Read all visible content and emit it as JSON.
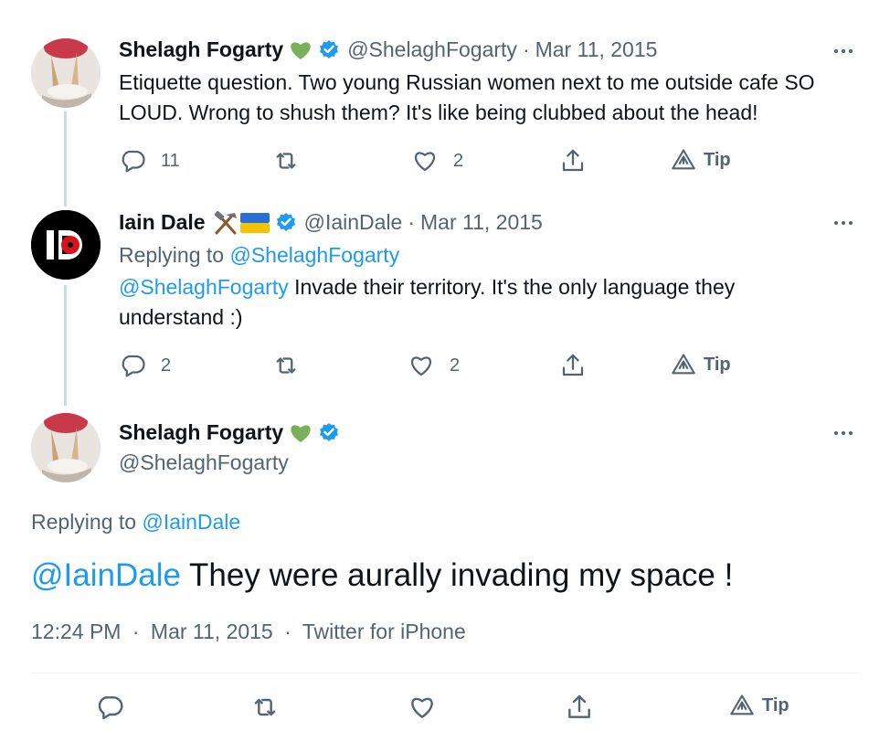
{
  "tweets": [
    {
      "name": "Shelagh Fogarty",
      "name_emoji": "green-heart",
      "handle": "@ShelaghFogarty",
      "sep": "·",
      "date": "Mar 11, 2015",
      "text": "Etiquette question. Two young Russian women next to me outside cafe SO LOUD. Wrong to shush them? It's like being clubbed about the head!",
      "actions": {
        "replies": "11",
        "likes": "2",
        "tip": "Tip"
      }
    },
    {
      "name": "Iain Dale",
      "name_emoji": "hammer-and-pick, flag-ukraine",
      "handle": "@IainDale",
      "sep": "·",
      "date": "Mar 11, 2015",
      "replying_prefix": "Replying to",
      "replying_to": "@ShelaghFogarty",
      "mention": "@ShelaghFogarty",
      "text": " Invade their territory. It's the only language they understand :)",
      "actions": {
        "replies": "2",
        "likes": "2",
        "tip": "Tip"
      }
    }
  ],
  "main": {
    "name": "Shelagh Fogarty",
    "handle": "@ShelaghFogarty",
    "replying_prefix": "Replying to",
    "replying_to": "@IainDale",
    "mention": "@IainDale",
    "text": " They were aurally invading my space !",
    "time": "12:24 PM",
    "sep": "·",
    "date": "Mar 11, 2015",
    "source": "Twitter for iPhone",
    "tip": "Tip"
  },
  "colors": {
    "accent": "#1d9bf0",
    "muted": "#536471",
    "heart": "#78b159",
    "verified": "#1d9bf0"
  }
}
